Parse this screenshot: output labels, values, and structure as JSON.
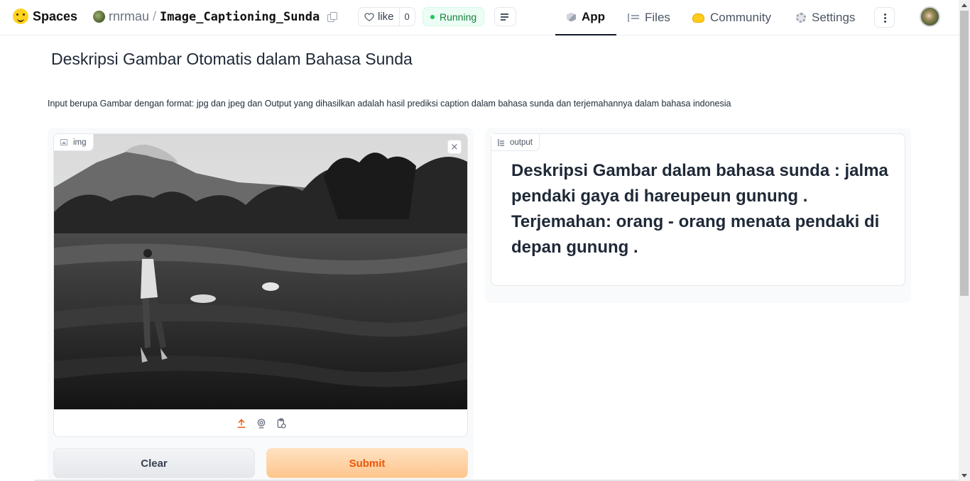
{
  "header": {
    "brand": "Spaces",
    "owner": "rnrmau",
    "separator": "/",
    "repo_name": "Image_Captioning_Sunda",
    "like_label": "like",
    "like_count": "0",
    "status": "Running",
    "status_color": "#22c55e",
    "tabs": [
      {
        "label": "App",
        "icon": "cube-icon",
        "active": true
      },
      {
        "label": "Files",
        "icon": "files-icon",
        "active": false
      },
      {
        "label": "Community",
        "icon": "community-icon",
        "active": false
      },
      {
        "label": "Settings",
        "icon": "gear-icon",
        "active": false
      }
    ]
  },
  "main": {
    "title": "Deskripsi Gambar Otomatis dalam Bahasa Sunda",
    "description": "Input berupa Gambar dengan format: jpg dan jpeg dan Output yang dihasilkan adalah hasil prediksi caption dalam bahasa sunda dan terjemahannya dalam bahasa indonesia",
    "input": {
      "label": "img",
      "image_description": "black-and-white photo: man walking across tilled field with volcano in background",
      "actions": [
        "upload-icon",
        "webcam-icon",
        "clipboard-icon"
      ]
    },
    "buttons": {
      "clear": "Clear",
      "submit": "Submit"
    },
    "output": {
      "label": "output",
      "text": "Deskripsi Gambar dalam bahasa sunda : jalma pendaki gaya di hareupeun gunung . Terjemahan: orang - orang menata pendaki di depan gunung ."
    }
  },
  "colors": {
    "accent": "#ea580c",
    "submit_bg": "#fdc58d",
    "clear_bg": "#e5e7eb"
  }
}
